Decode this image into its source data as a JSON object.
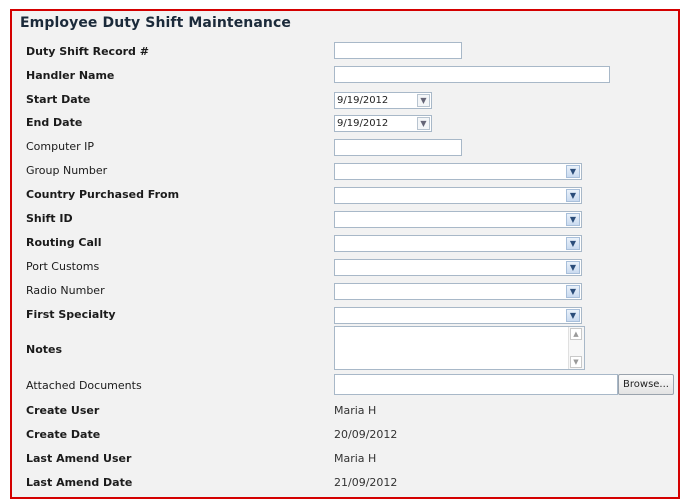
{
  "form": {
    "title": "Employee Duty Shift Maintenance",
    "labels": {
      "record": "Duty Shift Record #",
      "handler": "Handler Name",
      "start": "Start Date",
      "end": "End Date",
      "ip": "Computer IP",
      "group": "Group Number",
      "country": "Country Purchased From",
      "shift": "Shift ID",
      "routing": "Routing Call",
      "port": "Port Customs",
      "radio": "Radio Number",
      "specialty": "First Specialty",
      "notes": "Notes",
      "docs": "Attached Documents",
      "create_user": "Create User",
      "create_date": "Create Date",
      "amend_user": "Last Amend User",
      "amend_date": "Last Amend Date"
    },
    "values": {
      "record": "",
      "handler": "",
      "start": "9/19/2012",
      "end": "9/19/2012",
      "ip": "",
      "group": "",
      "country": "",
      "shift": "",
      "routing": "",
      "port": "",
      "radio": "",
      "specialty": "",
      "notes": "",
      "docs": "",
      "create_user": "Maria H",
      "create_date": "20/09/2012",
      "amend_user": "Maria H",
      "amend_date": "21/09/2012"
    },
    "browse_label": "Browse...",
    "icons": {
      "dropdown": "chevron-down-icon",
      "scroll_up": "scroll-up-icon",
      "scroll_down": "scroll-down-icon"
    }
  }
}
